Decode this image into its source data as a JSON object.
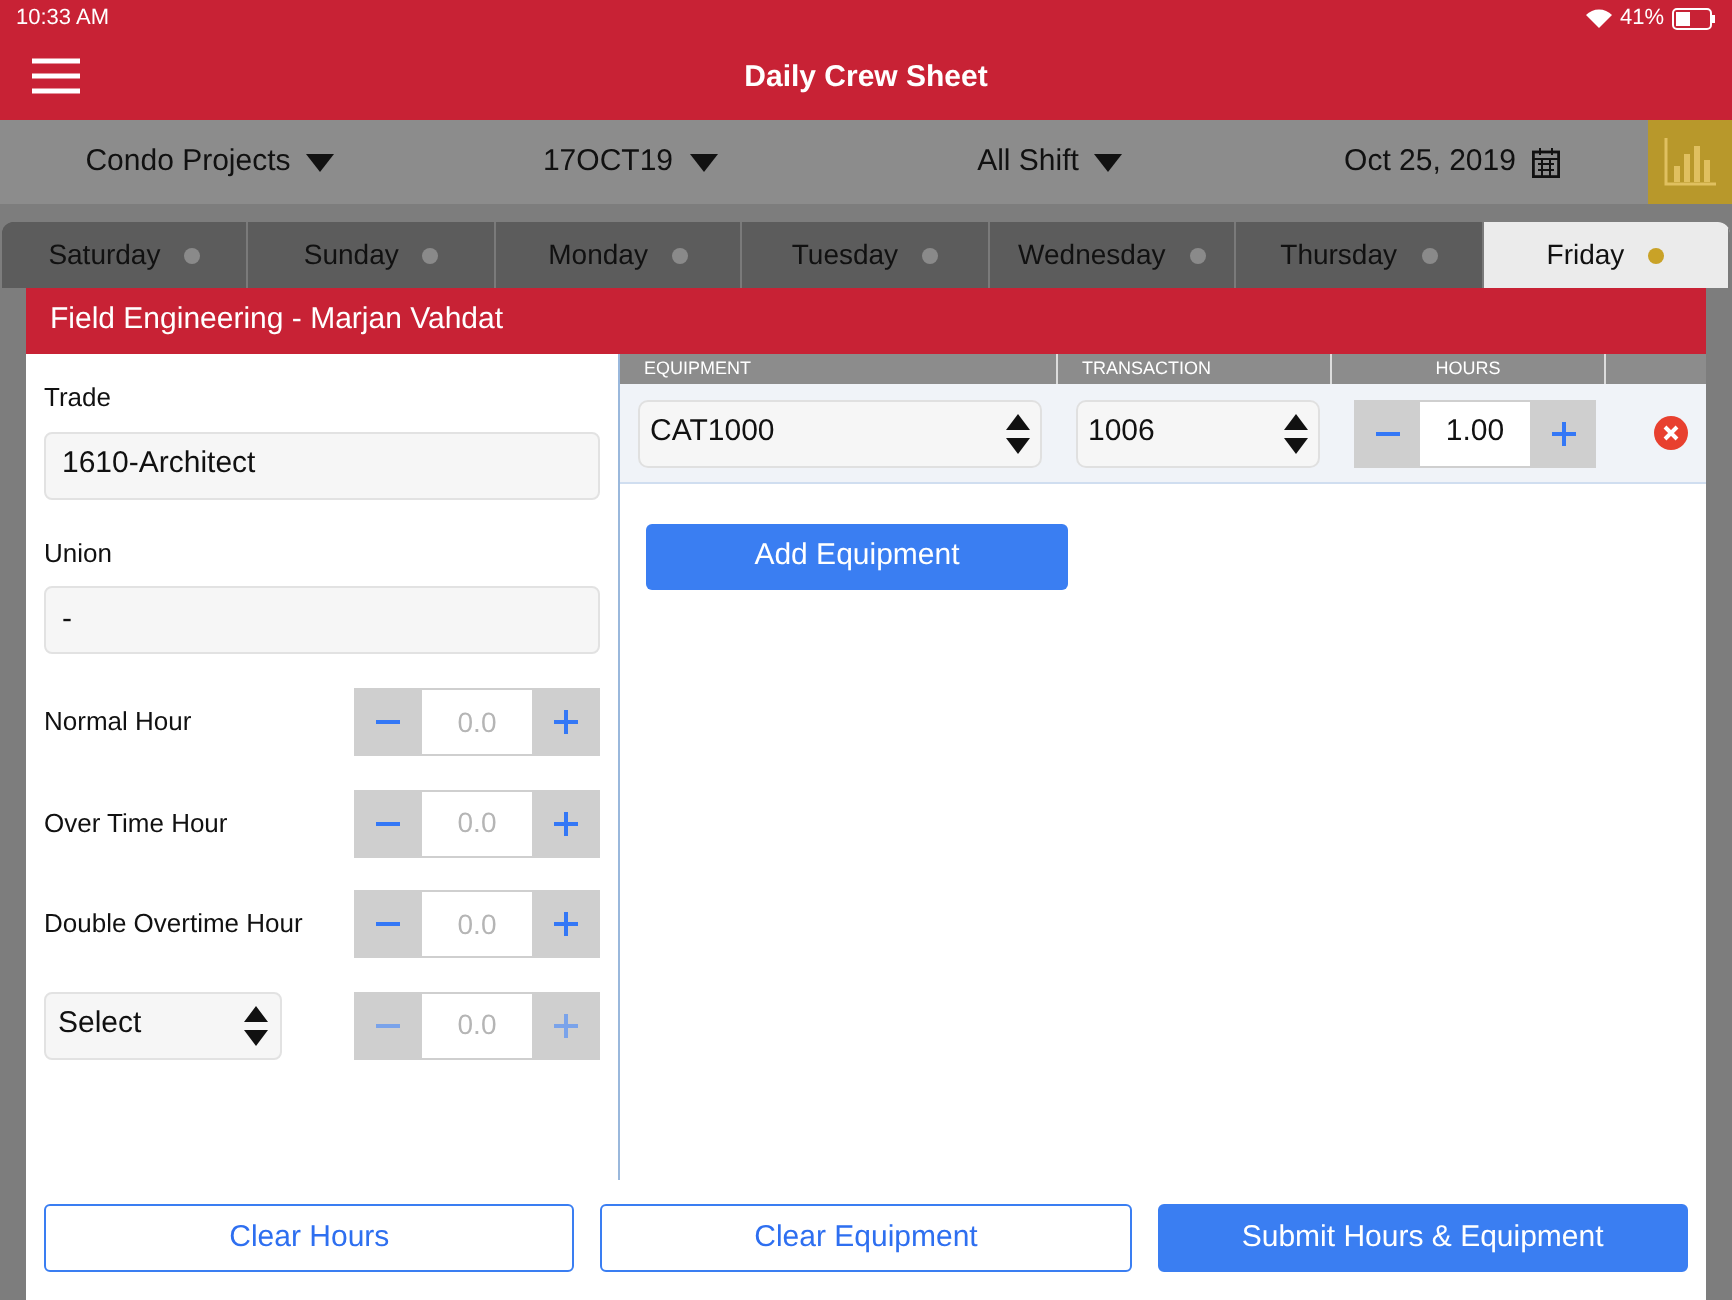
{
  "status_bar": {
    "time": "10:33 AM",
    "battery": "41%"
  },
  "header": {
    "title": "Daily Crew Sheet"
  },
  "filters": [
    {
      "kind": "dropdown",
      "label": "Condo Projects"
    },
    {
      "kind": "dropdown",
      "label": "17OCT19"
    },
    {
      "kind": "dropdown",
      "label": "All Shift"
    },
    {
      "kind": "date",
      "label": "Oct 25, 2019"
    }
  ],
  "day_tabs": [
    {
      "label": "Saturday",
      "selected": false,
      "color": "#8a8a8a"
    },
    {
      "label": "Sunday",
      "selected": false,
      "color": "#8a8a8a"
    },
    {
      "label": "Monday",
      "selected": false,
      "color": "#8a8a8a"
    },
    {
      "label": "Tuesday",
      "selected": false,
      "color": "#8a8a8a"
    },
    {
      "label": "Wednesday",
      "selected": false,
      "color": "#8a8a8a"
    },
    {
      "label": "Thursday",
      "selected": false,
      "color": "#8a8a8a"
    },
    {
      "label": "Friday",
      "selected": true,
      "color": "#c9a227"
    }
  ],
  "card": {
    "title": "Field Engineering - Marjan Vahdat",
    "fields": [
      {
        "label": "Trade",
        "value": "1610-Architect"
      },
      {
        "label": "Union",
        "value": "-"
      }
    ],
    "hours": [
      {
        "kind": "label",
        "label": "Normal Hour",
        "placeholder": "0.0",
        "disabled": false
      },
      {
        "kind": "label",
        "label": "Over Time Hour",
        "placeholder": "0.0",
        "disabled": false
      },
      {
        "kind": "label",
        "label": "Double Overtime Hour",
        "placeholder": "0.0",
        "disabled": false
      },
      {
        "kind": "select",
        "label": "Select",
        "placeholder": "0.0",
        "disabled": true
      }
    ],
    "equipment": {
      "columns": [
        "EQUIPMENT",
        "TRANSACTION",
        "HOURS"
      ],
      "rows": [
        {
          "equipment": "CAT1000",
          "transaction": "1006",
          "hours": "1.00"
        }
      ],
      "add_button": "Add Equipment"
    }
  },
  "buttons": [
    {
      "label": "Clear Hours",
      "kind": "outline"
    },
    {
      "label": "Clear Equipment",
      "kind": "outline"
    },
    {
      "label": "Submit Hours & Equipment",
      "kind": "primary"
    }
  ]
}
